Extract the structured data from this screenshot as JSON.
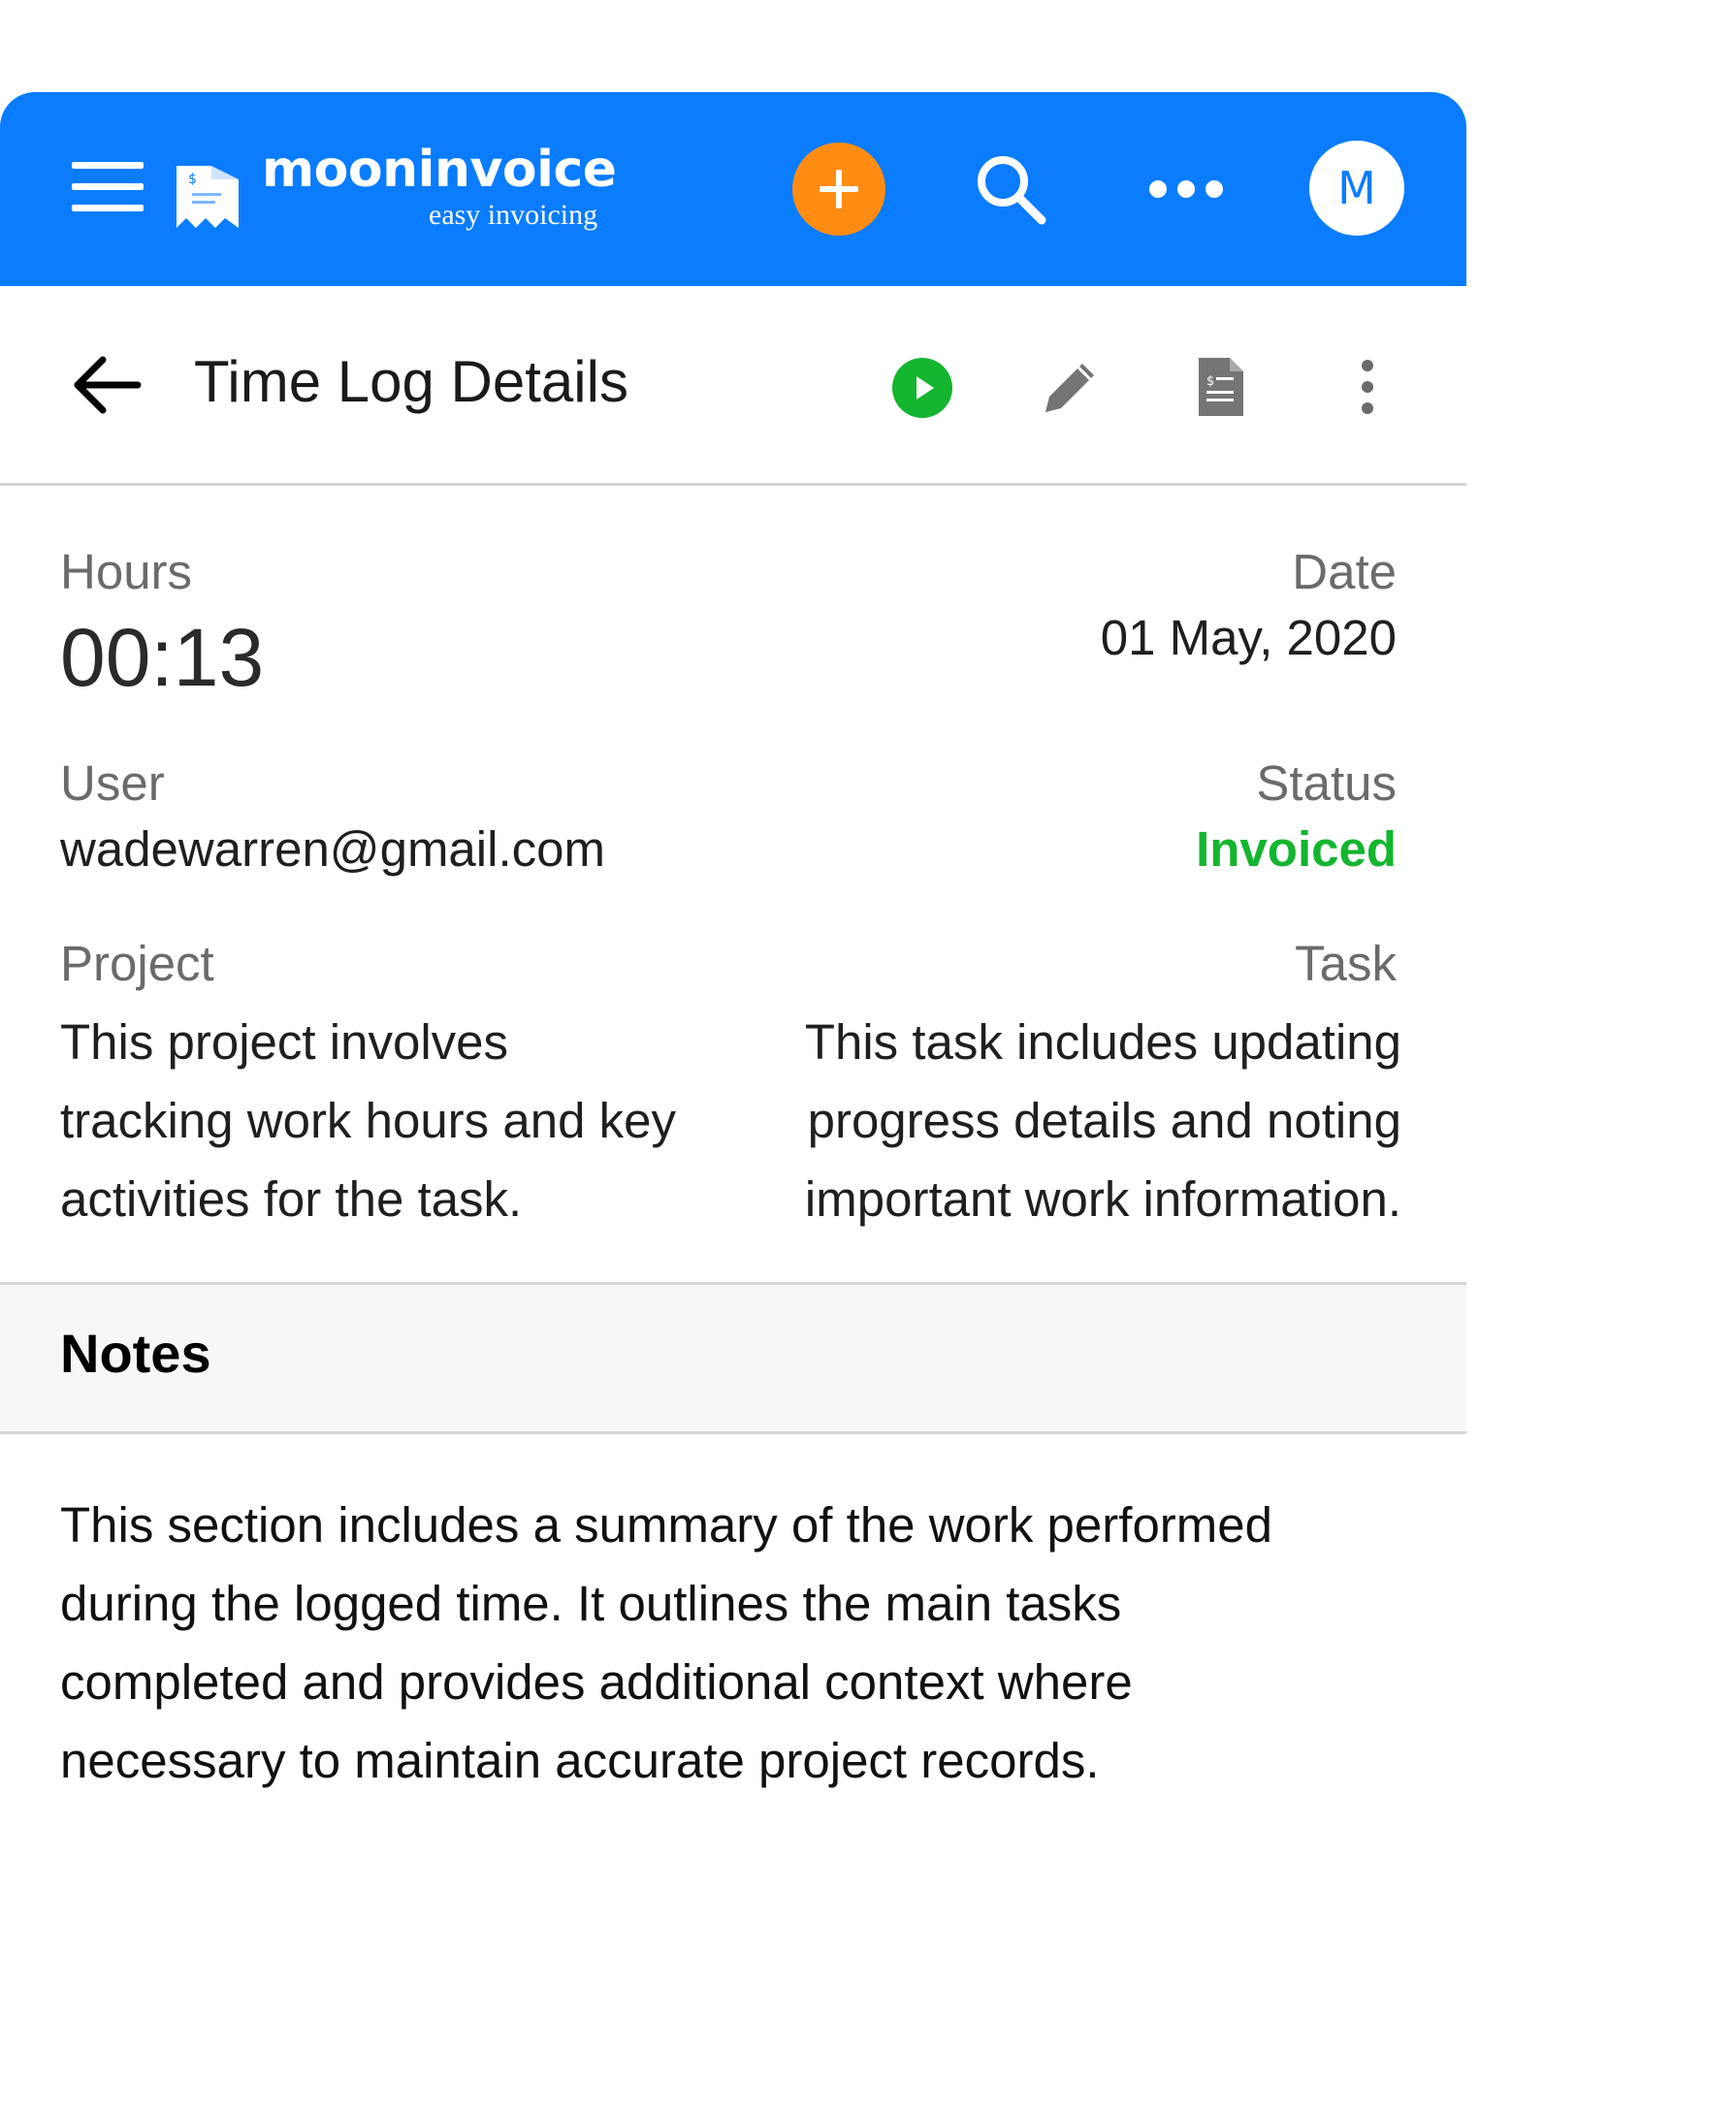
{
  "app": {
    "brand_name": "mooninvoice",
    "brand_tagline": "easy invoicing",
    "avatar_initial": "M",
    "accent_color": "#0a7cff",
    "add_button_color": "#ff8c12"
  },
  "toolbar": {
    "title": "Time Log Details",
    "icons": [
      "back-arrow-icon",
      "play-icon",
      "edit-icon",
      "document-icon",
      "more-vert-icon"
    ],
    "play_color": "#14b52f"
  },
  "details": {
    "hours_label": "Hours",
    "hours_value": "00:13",
    "date_label": "Date",
    "date_value": "01 May, 2020",
    "user_label": "User",
    "user_value": "wadewarren@gmail.com",
    "status_label": "Status",
    "status_value": "Invoiced",
    "status_color": "#14b52f",
    "project_label": "Project",
    "project_lines": [
      "This project involves",
      "tracking work hours and key",
      "activities for the task."
    ],
    "task_label": "Task",
    "task_lines": [
      "This task includes updating",
      "progress details and noting",
      "important work information."
    ]
  },
  "notes": {
    "title": "Notes",
    "lines": [
      "This section includes a summary of the work performed",
      "during the logged time. It outlines the main tasks",
      "completed and provides additional context where",
      "necessary to maintain accurate project records."
    ]
  }
}
